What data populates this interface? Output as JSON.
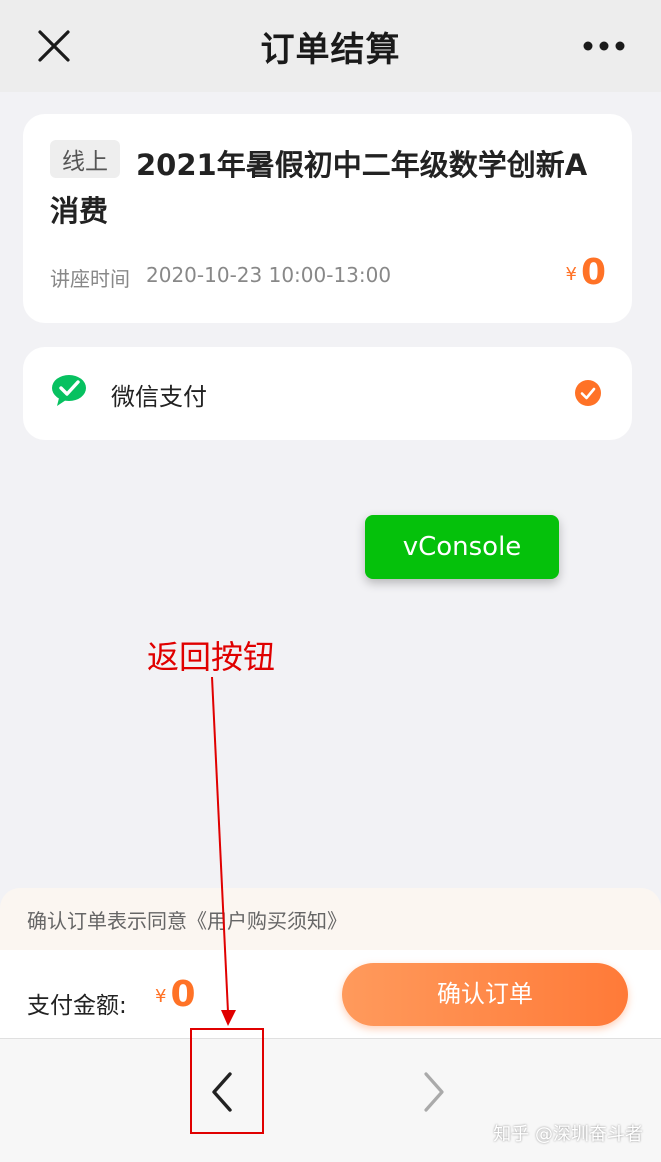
{
  "header": {
    "title": "订单结算",
    "close_icon": "close-icon",
    "more_icon": "more-icon"
  },
  "order": {
    "tag": "线上",
    "title": "2021年暑假初中二年级数学创新A消费",
    "time_label": "讲座时间",
    "time_value": "2020-10-23 10:00-13:00",
    "currency": "¥",
    "price": "0"
  },
  "payment": {
    "method": "微信支付",
    "icon": "wechat-icon",
    "selected": true
  },
  "vconsole": {
    "label": "vConsole"
  },
  "annotation": {
    "text": "返回按钮"
  },
  "agreement": {
    "text": "确认订单表示同意《用户购买须知》"
  },
  "checkout": {
    "amount_label": "支付金额:",
    "currency": "¥",
    "amount": "0",
    "confirm_label": "确认订单"
  },
  "browser_nav": {
    "back_icon": "chevron-left-icon",
    "forward_icon": "chevron-right-icon"
  },
  "watermark": {
    "text": "知乎 @深圳奋斗者"
  },
  "colors": {
    "accent": "#ff7226",
    "wechat_green": "#07c160",
    "vconsole_green": "#05c10b",
    "annotation_red": "#e00000"
  }
}
